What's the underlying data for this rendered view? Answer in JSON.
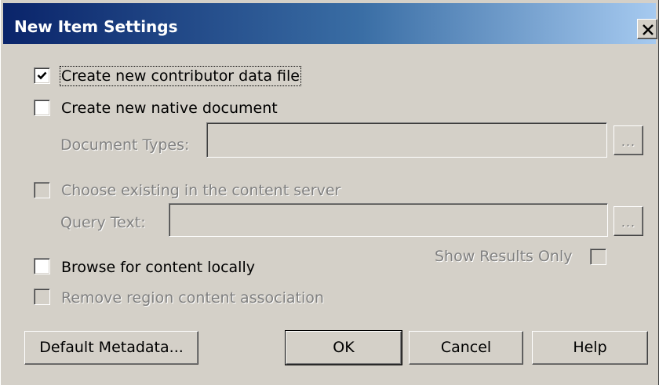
{
  "window": {
    "title": "New Item Settings",
    "close_symbol": "✕",
    "colors": {
      "face": "#d4d0c8",
      "title_start": "#0a246a",
      "title_end": "#a6caf0",
      "disabled_text": "#808080"
    }
  },
  "options": {
    "create_contributor": {
      "label": "Create new contributor data file",
      "checked": true,
      "enabled": true
    },
    "create_native": {
      "label": "Create new native document",
      "checked": false,
      "enabled": true
    },
    "document_types": {
      "label": "Document Types:",
      "value": "",
      "button": "...",
      "enabled": false
    },
    "choose_existing": {
      "label": "Choose existing in the content server",
      "checked": false,
      "enabled": false
    },
    "query_text": {
      "label": "Query Text:",
      "value": "",
      "button": "...",
      "enabled": false
    },
    "show_results_only": {
      "label": "Show Results Only",
      "checked": false,
      "enabled": false
    },
    "browse_local": {
      "label": "Browse for content locally",
      "checked": false,
      "enabled": true
    },
    "remove_association": {
      "label": "Remove region content association",
      "checked": false,
      "enabled": false
    }
  },
  "buttons": {
    "default_metadata": "Default Metadata...",
    "ok": "OK",
    "cancel": "Cancel",
    "help": "Help"
  }
}
